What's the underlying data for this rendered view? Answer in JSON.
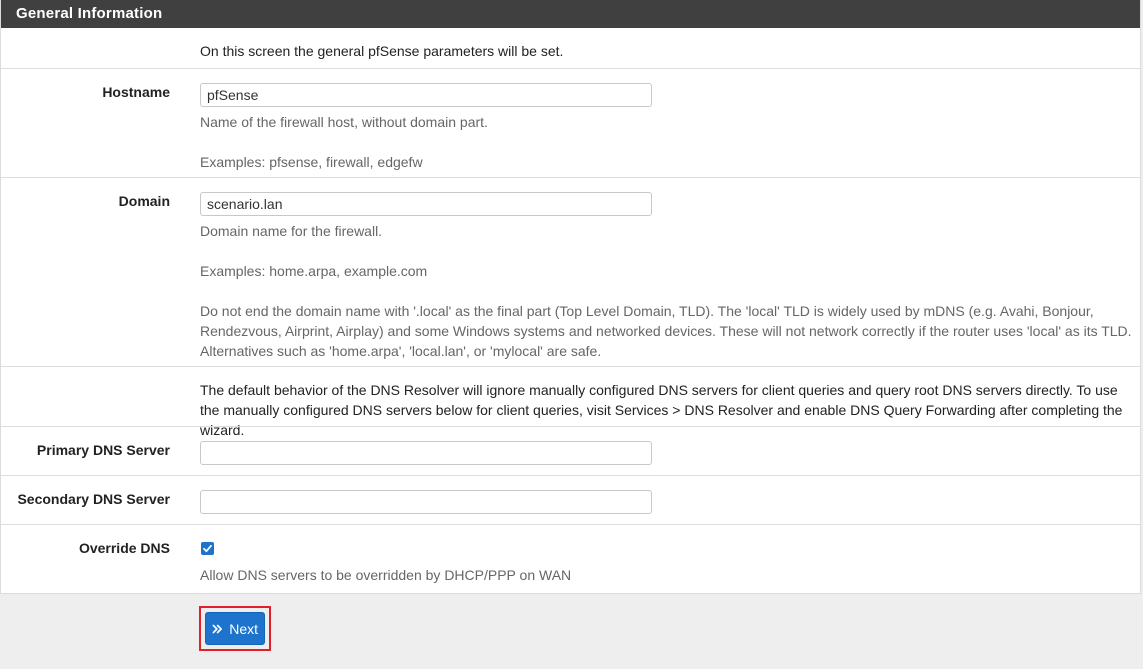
{
  "panel": {
    "title": "General Information"
  },
  "intro": "On this screen the general pfSense parameters will be set.",
  "hostname": {
    "label": "Hostname",
    "value": "pfSense",
    "help1": "Name of the firewall host, without domain part.",
    "help2": "Examples: pfsense, firewall, edgefw"
  },
  "domain": {
    "label": "Domain",
    "value": "scenario.lan",
    "help1": "Domain name for the firewall.",
    "help2": "Examples: home.arpa, example.com",
    "help3": "Do not end the domain name with '.local' as the final part (Top Level Domain, TLD). The 'local' TLD is widely used by mDNS (e.g. Avahi, Bonjour, Rendezvous, Airprint, Airplay) and some Windows systems and networked devices. These will not network correctly if the router uses 'local' as its TLD. Alternatives such as 'home.arpa', 'local.lan', or 'mylocal' are safe."
  },
  "dns_note": "The default behavior of the DNS Resolver will ignore manually configured DNS servers for client queries and query root DNS servers directly. To use the manually configured DNS servers below for client queries, visit Services > DNS Resolver and enable DNS Query Forwarding after completing the wizard.",
  "primary_dns": {
    "label": "Primary DNS Server",
    "value": ""
  },
  "secondary_dns": {
    "label": "Secondary DNS Server",
    "value": ""
  },
  "override_dns": {
    "label": "Override DNS",
    "checked": true,
    "help": "Allow DNS servers to be overridden by DHCP/PPP on WAN"
  },
  "next_button": {
    "label": "Next",
    "icon": "double-chevron-right-icon"
  },
  "colors": {
    "accent": "#1e74cc",
    "highlight": "#e0202b",
    "header": "#404040"
  }
}
